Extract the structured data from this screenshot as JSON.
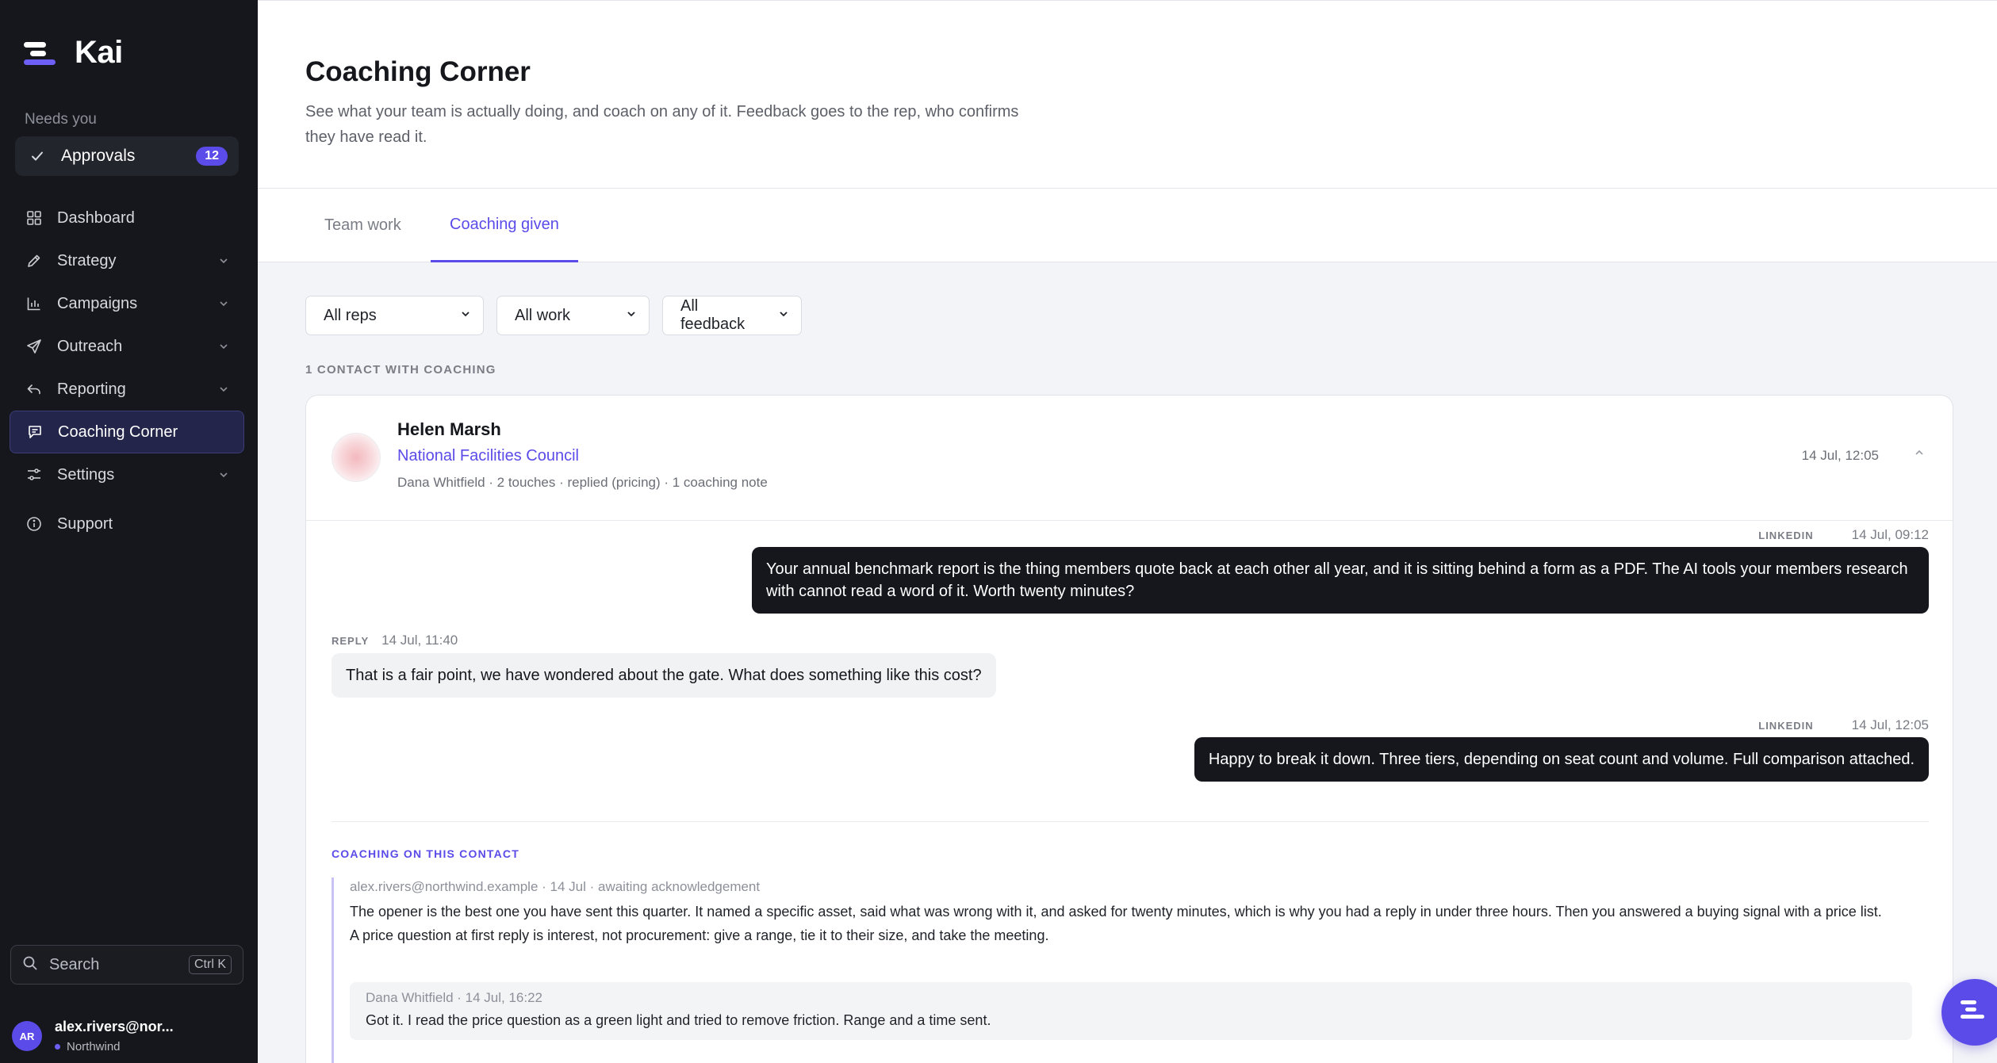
{
  "app": {
    "name": "Kai"
  },
  "sidebar": {
    "section_label": "Needs you",
    "approvals": {
      "label": "Approvals",
      "count": "12"
    },
    "items": [
      {
        "label": "Dashboard",
        "icon": "grid-icon"
      },
      {
        "label": "Strategy",
        "icon": "pen-icon"
      },
      {
        "label": "Campaigns",
        "icon": "bar-chart-icon"
      },
      {
        "label": "Outreach",
        "icon": "send-icon"
      },
      {
        "label": "Reporting",
        "icon": "reply-icon"
      },
      {
        "label": "Coaching Corner",
        "icon": "chat-icon"
      },
      {
        "label": "Settings",
        "icon": "sliders-icon"
      },
      {
        "label": "Support",
        "icon": "info-icon"
      }
    ],
    "search": {
      "label": "Search",
      "shortcut": "Ctrl K"
    },
    "user": {
      "initials": "AR",
      "email": "alex.rivers@nor...",
      "org": "Northwind"
    }
  },
  "header": {
    "title": "Coaching Corner",
    "subtitle": "See what your team is actually doing, and coach on any of it. Feedback goes to the rep, who confirms they have read it."
  },
  "tabs": [
    {
      "label": "Team work"
    },
    {
      "label": "Coaching given"
    }
  ],
  "filters": {
    "reps": "All reps",
    "work": "All work",
    "feedback": "All feedback"
  },
  "count_label": "1 CONTACT WITH COACHING",
  "contact": {
    "name": "Helen Marsh",
    "org": "National Facilities Council",
    "meta": "Dana Whitfield · 2 touches · replied (pricing) · 1 coaching note",
    "time": "14 Jul, 12:05"
  },
  "thread": [
    {
      "channel": "LINKEDIN",
      "time": "14 Jul, 09:12",
      "text": "Your annual benchmark report is the thing members quote back at each other all year, and it is sitting behind a form as a PDF. The AI tools your members research with cannot read a word of it. Worth twenty minutes?"
    },
    {
      "channel": "REPLY",
      "time": "14 Jul, 11:40",
      "text": "That is a fair point, we have wondered about the gate. What does something like this cost?"
    },
    {
      "channel": "LINKEDIN",
      "time": "14 Jul, 12:05",
      "text": "Happy to break it down. Three tiers, depending on seat count and volume. Full comparison attached."
    }
  ],
  "coaching": {
    "label": "COACHING ON THIS CONTACT",
    "meta": "alex.rivers@northwind.example · 14 Jul · awaiting acknowledgement",
    "text": "The opener is the best one you have sent this quarter. It named a specific asset, said what was wrong with it, and asked for twenty minutes, which is why you had a reply in under three hours. Then you answered a buying signal with a price list. A price question at first reply is interest, not procurement: give a range, tie it to their size, and take the meeting.",
    "reply": {
      "meta": "Dana Whitfield · 14 Jul, 16:22",
      "text": "Got it. I read the price question as a green light and tried to remove friction. Range and a time sent."
    }
  },
  "colors": {
    "accent": "#5b4be8",
    "sidebar_bg": "#15171c",
    "bubble_dark": "#15171c"
  }
}
